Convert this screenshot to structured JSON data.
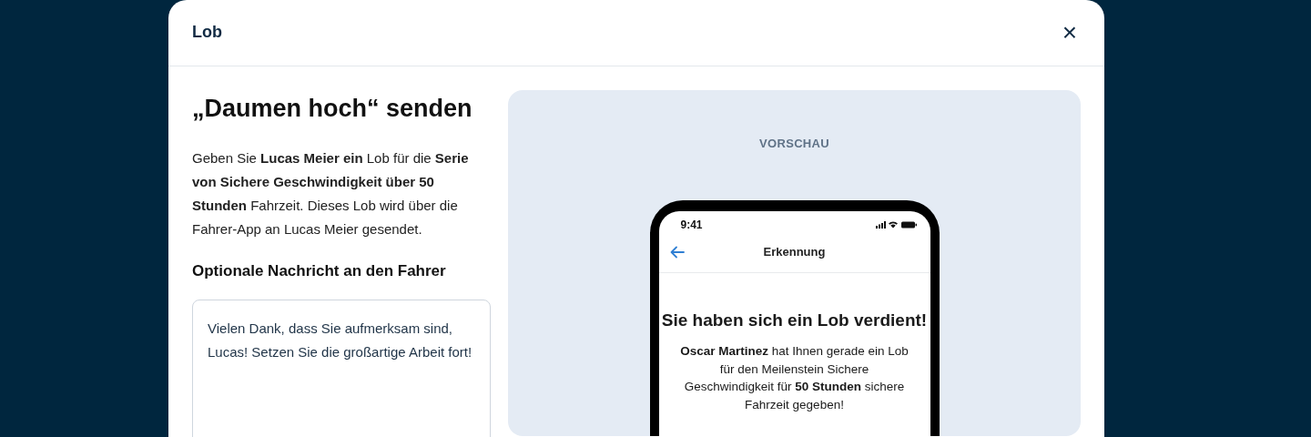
{
  "dialog": {
    "title": "Lob",
    "close_label": "×"
  },
  "heading": "„Daumen hoch“ senden",
  "description": "Geben Sie **Lucas Meier ein** Lob für die **Serie von Sichere Geschwindigkeit über 50 Stunden** Fahrzeit. Dieses Lob wird über die Fahrer-App an Lucas Meier gesendet.",
  "message": {
    "label": "Optionale Nachricht an den Fahrer",
    "value": "Vielen Dank, dass Sie aufmerksam sind, Lucas! Setzen Sie die großartige Arbeit fort!"
  },
  "preview": {
    "label": "VORSCHAU",
    "phone": {
      "time": "9:41",
      "screen_title": "Erkennung",
      "headline": "Sie haben sich ein Lob verdient!",
      "body": "**Oscar Martinez** hat Ihnen gerade ein Lob für den Meilenstein Sichere Geschwindigkeit für **50 Stunden** sichere Fahrzeit gegeben!"
    }
  }
}
